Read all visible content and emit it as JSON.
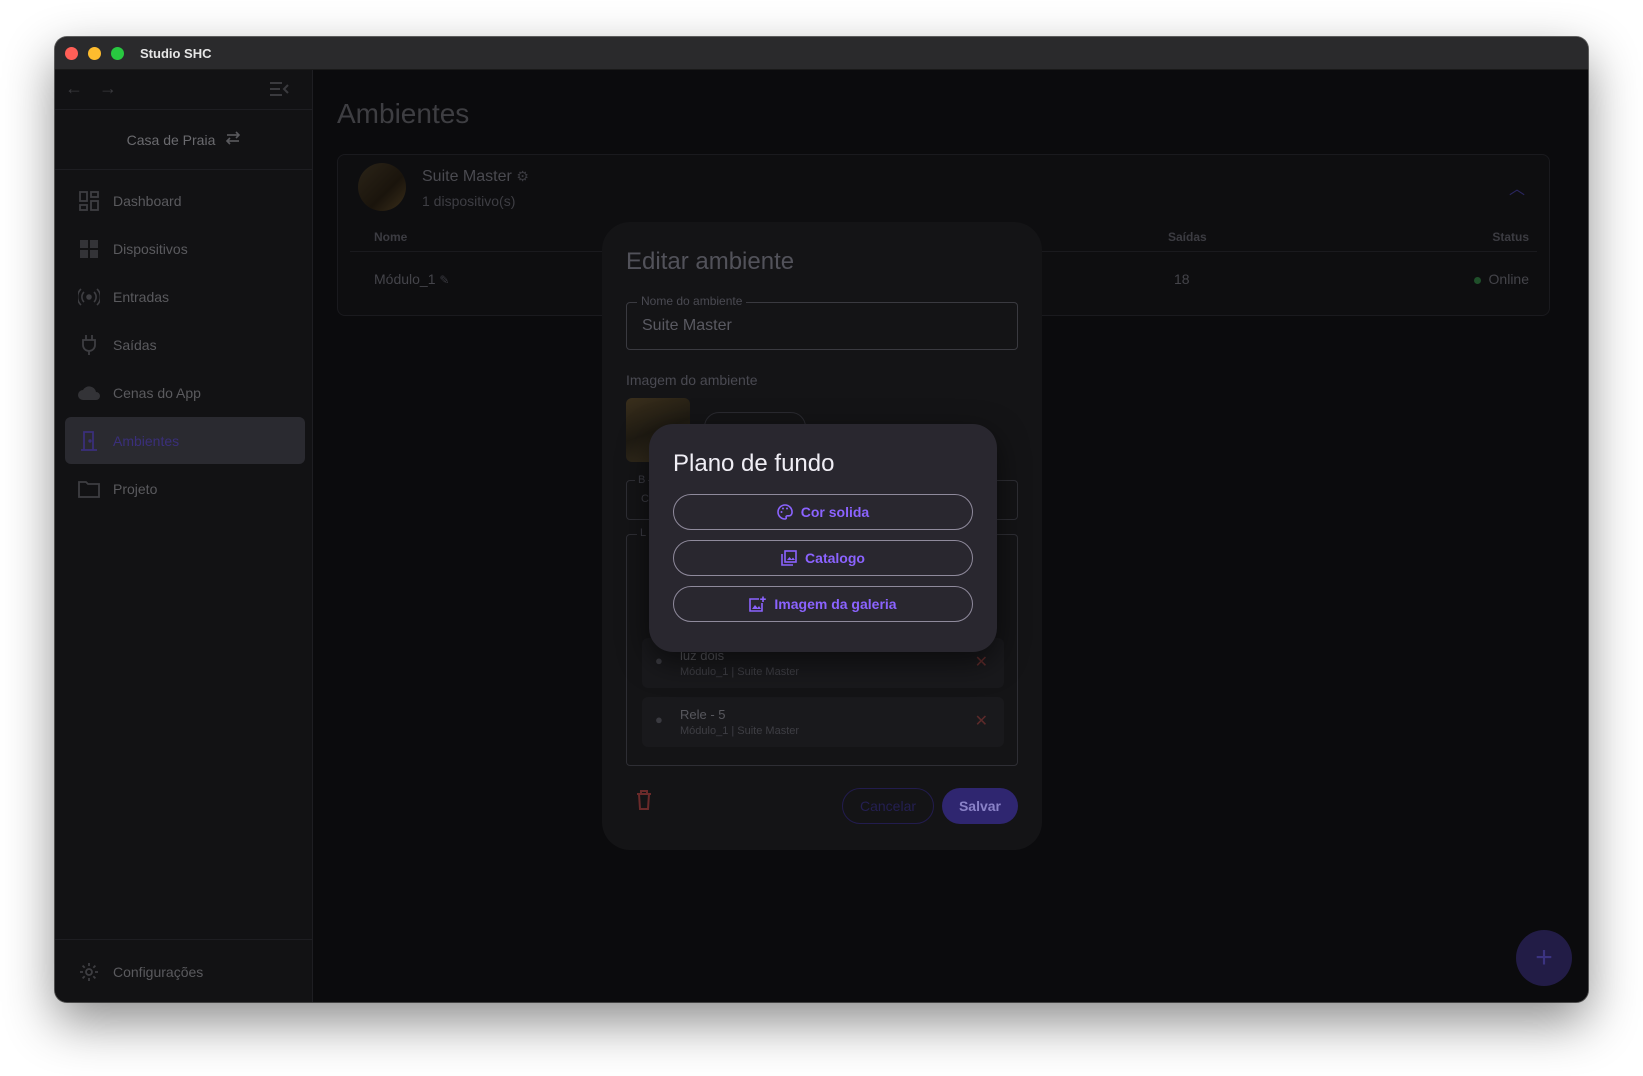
{
  "window": {
    "title": "Studio SHC"
  },
  "sidebar": {
    "project": "Casa de Praia",
    "items": [
      {
        "label": "Dashboard",
        "icon": "dashboard-icon"
      },
      {
        "label": "Dispositivos",
        "icon": "devices-icon"
      },
      {
        "label": "Entradas",
        "icon": "inputs-icon"
      },
      {
        "label": "Saídas",
        "icon": "plug-icon"
      },
      {
        "label": "Cenas do App",
        "icon": "cloud-icon"
      },
      {
        "label": "Ambientes",
        "icon": "door-icon"
      },
      {
        "label": "Projeto",
        "icon": "folder-icon"
      }
    ],
    "settings": "Configurações"
  },
  "main": {
    "title": "Ambientes",
    "environment": {
      "name": "Suite Master",
      "subtitle": "1 dispositivo(s)",
      "columns": {
        "name": "Nome",
        "outputs": "Saídas",
        "status": "Status"
      },
      "row": {
        "name": "Módulo_1",
        "outputs": "18",
        "status": "Online"
      }
    }
  },
  "edit_dialog": {
    "title": "Editar ambiente",
    "name_label": "Nome do ambiente",
    "name_value": "Suite Master",
    "image_label": "Imagem do ambiente",
    "select_label": "B",
    "select_value": "C",
    "list_label": "L",
    "outputs": [
      {
        "name": "luz dois",
        "sub": "Módulo_1 | Suite Master"
      },
      {
        "name": "Rele - 5",
        "sub": "Módulo_1 | Suite Master"
      }
    ],
    "cancel": "Cancelar",
    "save": "Salvar"
  },
  "bg_dialog": {
    "title": "Plano de fundo",
    "options": [
      {
        "label": "Cor solida",
        "icon": "palette-icon"
      },
      {
        "label": "Catalogo",
        "icon": "image-library-icon"
      },
      {
        "label": "Imagem da galeria",
        "icon": "add-photo-icon"
      }
    ]
  },
  "colors": {
    "accent": "#8b63ff",
    "online": "#2f9a4a",
    "danger": "#b04040"
  }
}
